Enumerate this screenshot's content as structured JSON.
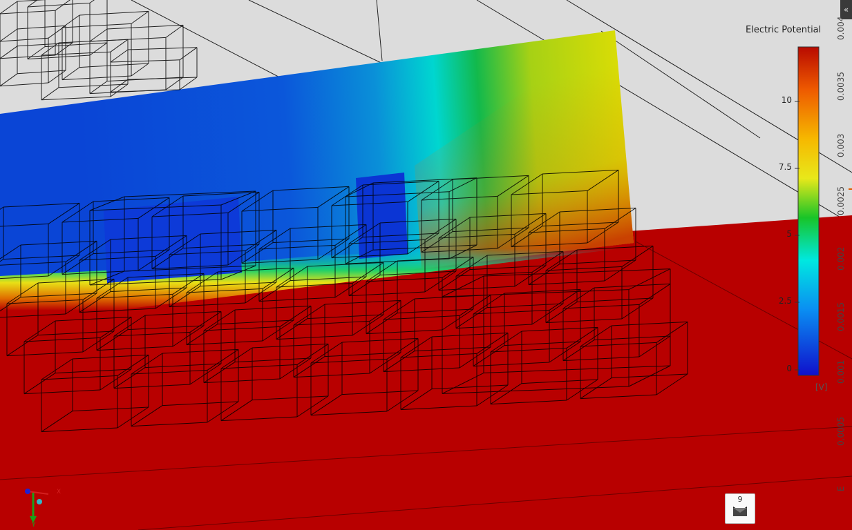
{
  "legend": {
    "title": "Electric Potential",
    "unit": "[V]",
    "ticks": [
      "10",
      "7.5",
      "5",
      "2.5",
      "0"
    ],
    "min": 0,
    "max": 12
  },
  "axis": {
    "labels": [
      "0.004",
      "0.0035",
      "0.003",
      "0.0025",
      "0.002",
      "0.0015",
      "0.001",
      "0.0005",
      "E"
    ]
  },
  "triad": {
    "x": "X",
    "y": "Y"
  },
  "notifications": {
    "count": "9"
  },
  "colors": {
    "background": "#dcdcdc",
    "substrate": "#b80000",
    "field_low": "#0a49d8",
    "field_high": "#d7dd06",
    "wireframe": "#000000"
  },
  "icons": {
    "collapse": "double-chevron-left-icon",
    "mail": "envelope-icon",
    "triad": "axis-triad-icon"
  }
}
